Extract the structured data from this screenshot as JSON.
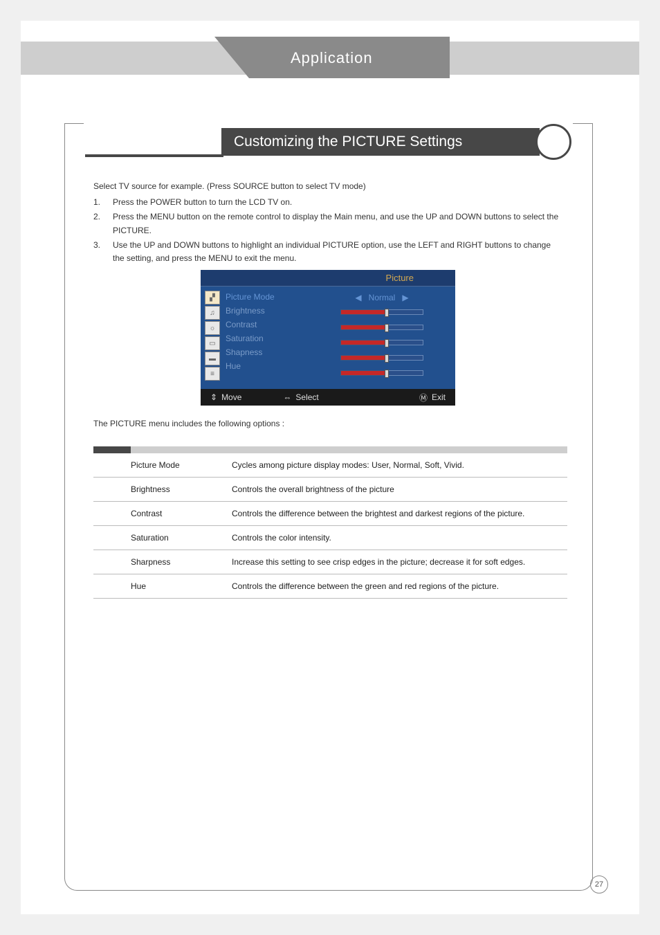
{
  "header": {
    "title": "Application"
  },
  "section": {
    "title": "Customizing the PICTURE Settings"
  },
  "intro": "Select TV source for example. (Press SOURCE button to select TV mode)",
  "steps": [
    {
      "num": "1.",
      "text": "Press the POWER button to turn the LCD TV on."
    },
    {
      "num": "2.",
      "text": "Press the MENU button on the remote control to display the Main menu, and use the UP and DOWN buttons to select the PICTURE."
    },
    {
      "num": "3.",
      "text": "Use the UP and DOWN buttons to highlight an individual PICTURE option, use the LEFT and RIGHT buttons to change the setting, and press the MENU to exit the menu."
    }
  ],
  "osd": {
    "title": "Picture",
    "items": [
      {
        "label": "Picture Mode",
        "value": "Normal",
        "selected": true
      },
      {
        "label": "Brightness"
      },
      {
        "label": "Contrast"
      },
      {
        "label": "Saturation"
      },
      {
        "label": "Shapness"
      },
      {
        "label": "Hue"
      }
    ],
    "footer": {
      "move": "Move",
      "select": "Select",
      "exit": "Exit"
    }
  },
  "subheading": "The PICTURE menu includes the following options :",
  "options": [
    {
      "name": "Picture Mode",
      "desc": "Cycles among picture display modes: User, Normal, Soft, Vivid."
    },
    {
      "name": "Brightness",
      "desc": "Controls the overall brightness of the picture"
    },
    {
      "name": "Contrast",
      "desc": "Controls the difference between the brightest and darkest regions of the picture."
    },
    {
      "name": "Saturation",
      "desc": "Controls the color intensity."
    },
    {
      "name": "Sharpness",
      "desc": "Increase this setting to see crisp edges in the picture; decrease it for soft edges."
    },
    {
      "name": "Hue",
      "desc": "Controls the difference between the green and red regions of the picture."
    }
  ],
  "page_number": "27"
}
